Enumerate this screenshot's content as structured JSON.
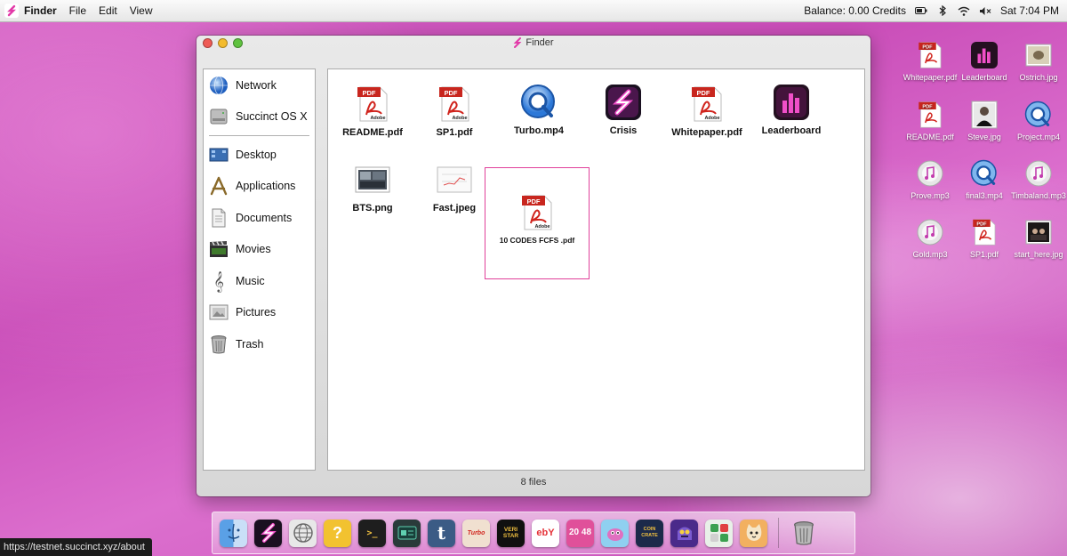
{
  "menubar": {
    "app_name": "Finder",
    "menus": [
      "File",
      "Edit",
      "View"
    ],
    "balance": "Balance:",
    "credits": "0.00 Credits",
    "clock": "Sat 7:04 PM"
  },
  "window": {
    "title": "Finder",
    "sidebar": {
      "devices": [
        {
          "label": "Network",
          "icon": "globe-icon"
        },
        {
          "label": "Succinct OS X",
          "icon": "hard-drive-icon"
        }
      ],
      "places": [
        {
          "label": "Desktop",
          "icon": "desktop-icon"
        },
        {
          "label": "Applications",
          "icon": "applications-icon"
        },
        {
          "label": "Documents",
          "icon": "document-icon"
        },
        {
          "label": "Movies",
          "icon": "movies-icon"
        },
        {
          "label": "Music",
          "icon": "music-icon"
        },
        {
          "label": "Pictures",
          "icon": "pictures-icon"
        },
        {
          "label": "Trash",
          "icon": "trash-icon"
        }
      ]
    },
    "files": [
      {
        "name": "README.pdf",
        "icon": "pdf-icon"
      },
      {
        "name": "SP1.pdf",
        "icon": "pdf-icon"
      },
      {
        "name": "Turbo.mp4",
        "icon": "quicktime-icon"
      },
      {
        "name": "Crisis",
        "icon": "succinct-app-icon"
      },
      {
        "name": "Whitepaper.pdf",
        "icon": "pdf-icon"
      },
      {
        "name": "Leaderboard",
        "icon": "leaderboard-app-icon"
      },
      {
        "name": "BTS.png",
        "icon": "image-icon"
      },
      {
        "name": "Fast.jpeg",
        "icon": "image-icon"
      },
      {
        "name": "10 CODES FCFS .pdf",
        "icon": "pdf-icon",
        "selected": true
      }
    ],
    "status": "8 files"
  },
  "desktop": [
    {
      "name": "Whitepaper.pdf",
      "icon": "pdf-icon"
    },
    {
      "name": "Leaderboard",
      "icon": "leaderboard-app-icon"
    },
    {
      "name": "Ostrich.jpg",
      "icon": "image-icon"
    },
    {
      "name": "README.pdf",
      "icon": "pdf-icon"
    },
    {
      "name": "Steve.jpg",
      "icon": "image-icon"
    },
    {
      "name": "Project.mp4",
      "icon": "quicktime-icon"
    },
    {
      "name": "Prove.mp3",
      "icon": "itunes-icon"
    },
    {
      "name": "final3.mp4",
      "icon": "quicktime-icon"
    },
    {
      "name": "Timbaland.mp3",
      "icon": "itunes-icon"
    },
    {
      "name": "Gold.mp3",
      "icon": "itunes-icon"
    },
    {
      "name": "SP1.pdf",
      "icon": "pdf-icon"
    },
    {
      "name": "start_here.jpg",
      "icon": "image-icon"
    }
  ],
  "dock": [
    {
      "name": "finder",
      "icon": "finder-icon"
    },
    {
      "name": "succinct",
      "icon": "succinct-app-icon"
    },
    {
      "name": "network",
      "icon": "globe-icon"
    },
    {
      "name": "help",
      "icon": "question-icon",
      "text": "?"
    },
    {
      "name": "terminal",
      "icon": "terminal-icon",
      "text": ">_"
    },
    {
      "name": "device",
      "icon": "circuit-icon"
    },
    {
      "name": "tumblr",
      "icon": "tumblr-icon",
      "text": "t"
    },
    {
      "name": "turbo",
      "icon": "turbo-icon",
      "text": "Turbo"
    },
    {
      "name": "veri-star",
      "icon": "veri-star-icon",
      "text": "VERI STAR"
    },
    {
      "name": "ebay",
      "icon": "ebay-icon",
      "text": "ebY"
    },
    {
      "name": "2048",
      "icon": "2048-icon",
      "text": "20 48"
    },
    {
      "name": "creature",
      "icon": "creature-icon"
    },
    {
      "name": "coin-crate",
      "icon": "coin-crate-icon",
      "text": "COIN CRATE"
    },
    {
      "name": "monster",
      "icon": "monster-icon"
    },
    {
      "name": "puzzle",
      "icon": "puzzle-icon"
    },
    {
      "name": "cat",
      "icon": "cat-icon"
    },
    {
      "name": "trash",
      "icon": "trash-icon"
    }
  ],
  "status_url": "https://testnet.succinct.xyz/about",
  "colors": {
    "accent": "#e0409a",
    "dock_bg": "#ffffff",
    "selection": "#e0409a"
  }
}
